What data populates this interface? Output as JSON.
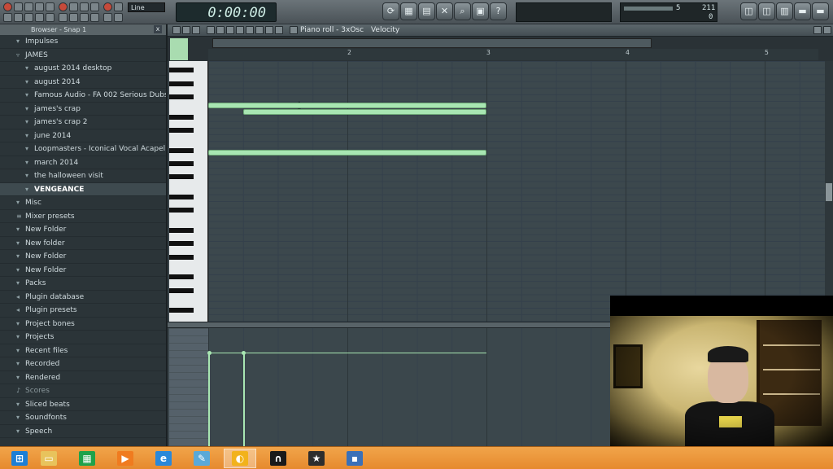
{
  "toolbar": {
    "line_select": "Line",
    "time_display": "0:00:00",
    "meter_values": [
      "5",
      "211",
      "0"
    ]
  },
  "browser": {
    "title": "Browser - Snap 1",
    "items": [
      {
        "label": "Impulses",
        "level": 0,
        "icon": "folder-icon"
      },
      {
        "label": "JAMES",
        "level": 0,
        "icon": "folder-open-icon"
      },
      {
        "label": "august 2014 desktop",
        "level": 1,
        "icon": "folder-icon"
      },
      {
        "label": "august 2014",
        "level": 1,
        "icon": "folder-icon"
      },
      {
        "label": "Famous Audio - FA 002 Serious Dubs...",
        "level": 1,
        "icon": "folder-icon"
      },
      {
        "label": "james's crap",
        "level": 1,
        "icon": "folder-icon"
      },
      {
        "label": "james's crap 2",
        "level": 1,
        "icon": "folder-icon"
      },
      {
        "label": "june 2014",
        "level": 1,
        "icon": "folder-icon"
      },
      {
        "label": "Loopmasters - Iconical Vocal Acapel...",
        "level": 1,
        "icon": "folder-icon"
      },
      {
        "label": "march 2014",
        "level": 1,
        "icon": "folder-icon"
      },
      {
        "label": "the halloween visit",
        "level": 1,
        "icon": "folder-icon"
      },
      {
        "label": "VENGEANCE",
        "level": 1,
        "icon": "folder-icon",
        "selected": true
      },
      {
        "label": "Misc",
        "level": 0,
        "icon": "folder-icon"
      },
      {
        "label": "Mixer presets",
        "level": 0,
        "icon": "mixer-icon"
      },
      {
        "label": "New Folder",
        "level": 0,
        "icon": "folder-icon"
      },
      {
        "label": "New folder",
        "level": 0,
        "icon": "folder-icon"
      },
      {
        "label": "New Folder",
        "level": 0,
        "icon": "folder-icon"
      },
      {
        "label": "New Folder",
        "level": 0,
        "icon": "folder-icon"
      },
      {
        "label": "Packs",
        "level": 0,
        "icon": "folder-icon"
      },
      {
        "label": "Plugin database",
        "level": 0,
        "icon": "plugin-icon"
      },
      {
        "label": "Plugin presets",
        "level": 0,
        "icon": "plugin-icon"
      },
      {
        "label": "Project bones",
        "level": 0,
        "icon": "folder-icon"
      },
      {
        "label": "Projects",
        "level": 0,
        "icon": "folder-icon"
      },
      {
        "label": "Recent files",
        "level": 0,
        "icon": "folder-icon"
      },
      {
        "label": "Recorded",
        "level": 0,
        "icon": "folder-icon"
      },
      {
        "label": "Rendered",
        "level": 0,
        "icon": "folder-icon"
      },
      {
        "label": "Scores",
        "level": 0,
        "icon": "score-icon",
        "dim": true
      },
      {
        "label": "Sliced beats",
        "level": 0,
        "icon": "folder-icon"
      },
      {
        "label": "Soundfonts",
        "level": 0,
        "icon": "folder-icon"
      },
      {
        "label": "Speech",
        "level": 0,
        "icon": "folder-icon"
      }
    ]
  },
  "piano_roll": {
    "title": "Piano roll - 3xOsc",
    "target": "Velocity",
    "ruler": [
      "2",
      "3",
      "4",
      "5"
    ],
    "notes": [
      {
        "bar_start": 1.0,
        "bar_end": 3.0,
        "row": 6
      },
      {
        "bar_start": 1.25,
        "bar_end": 3.0,
        "row": 7
      },
      {
        "bar_start": 1.0,
        "bar_end": 3.0,
        "row": 13
      }
    ]
  },
  "taskbar": {
    "apps": [
      {
        "name": "start-icon",
        "color": "#1c7fd6"
      },
      {
        "name": "file-explorer-icon",
        "color": "#e8c35c"
      },
      {
        "name": "store-icon",
        "color": "#1fa24a"
      },
      {
        "name": "media-player-icon",
        "color": "#f07b1f"
      },
      {
        "name": "internet-explorer-icon",
        "color": "#2a88d9"
      },
      {
        "name": "paint-icon",
        "color": "#5aa9d8"
      },
      {
        "name": "fl-studio-icon",
        "color": "#f2b21b"
      },
      {
        "name": "headphones-icon",
        "color": "#1a1a1a"
      },
      {
        "name": "movie-maker-icon",
        "color": "#2d2d2d"
      },
      {
        "name": "disk-icon",
        "color": "#3a70b8"
      }
    ]
  }
}
